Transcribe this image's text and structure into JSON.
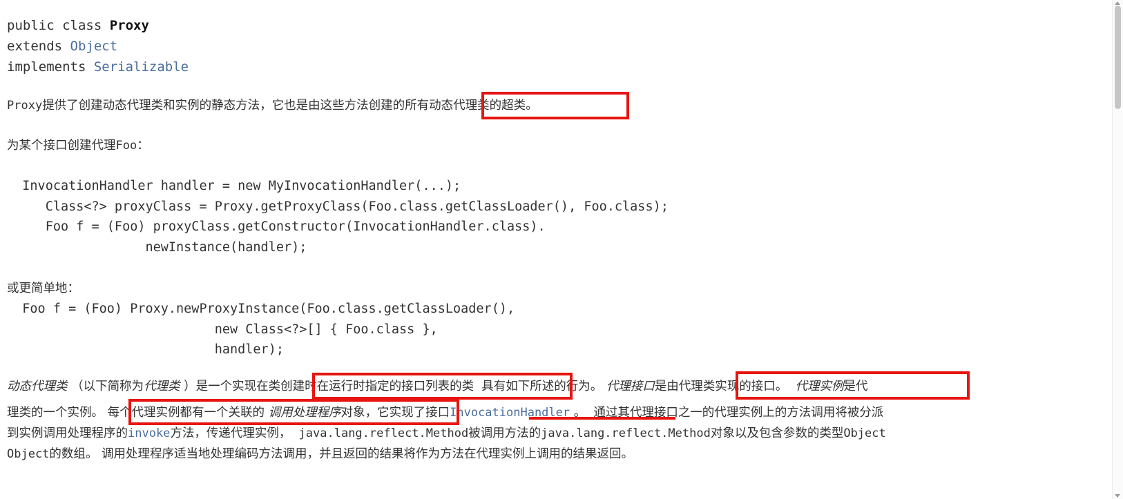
{
  "signature": {
    "line1_pre": "public class ",
    "line1_class": "Proxy",
    "line2_pre": "extends ",
    "line2_link": "Object",
    "line3_pre": "implements ",
    "line3_link": "Serializable"
  },
  "intro": {
    "part1": "Proxy",
    "part2": "提供了创建动态代理类和实例的静态方法，它也是由这些方法创建的",
    "highlight": "所有动态代理类的超类",
    "part3": "。"
  },
  "create_for_interface": {
    "text_pre": "为某个接口创建代理",
    "text_mono": "Foo",
    "text_post": "："
  },
  "code_block_1": {
    "line1": "  InvocationHandler handler = new MyInvocationHandler(...);",
    "line2": "     Class<?> proxyClass = Proxy.getProxyClass(Foo.class.getClassLoader(), Foo.class);",
    "line3": "     Foo f = (Foo) proxyClass.getConstructor(InvocationHandler.class).",
    "line4": "                  newInstance(handler);"
  },
  "simpler_label": "或更简单地：",
  "code_block_2": {
    "line1": "  Foo f = (Foo) Proxy.newProxyInstance(Foo.class.getClassLoader(),",
    "line2": "                           new Class<?>[] { Foo.class },",
    "line3": "                           handler);"
  },
  "body_paragraph": {
    "l1_a_italic": "动态代理类",
    "l1_b": " （以下简称为",
    "l1_c_italic": "代理类",
    "l1_d": " ）是一个实现",
    "l1_highlight1": "在类创建时在运行时指定的接口列表的类",
    "l1_e": "  具有如下所述的行为。 ",
    "l1_highlight2_italic": "代理接口",
    "l1_highlight2_rest": "是由代理类实现的接口。",
    "l1_f_italic": "代理实例",
    "l1_g": "是代",
    "l2_a": "理类的一个实例。 ",
    "l2_highlight_a": "每个代理实例都有一个关联的 ",
    "l2_highlight_b_italic": "调用处理程序",
    "l2_highlight_c": "对象，",
    "l2_b": "它实现了接口",
    "l2_link": "InvocationHandler",
    "l2_c": " 。  通过其代理接口之一的代理实例上的方法调用将被分派",
    "l3_a": "到实例调用处理程序的",
    "l3_link": "invoke",
    "l3_b": "方法，传递代理实例，  ",
    "l3_mono1": "java.lang.reflect.Method",
    "l3_c": "被调用方法的",
    "l3_mono2": "java.lang.reflect.Method",
    "l3_d": "对象以及包含参数的类型",
    "l3_mono3": "Object",
    "l4_mono": "Object",
    "l4_a": "的数组。 调用处理程序适当地处理编码方法调用，并且返回的结果将作为方法在代理实例上调用的结果返回。"
  },
  "annotations": {
    "accent_color": "#e8140f",
    "link_color": "#4a6d9e",
    "box1_label": "highlight-superclass",
    "box2_label": "highlight-interface-list",
    "box3_label": "highlight-proxy-interface",
    "box4_label": "highlight-invocation-handler-object",
    "underline_label": "underline-invocation-handler-link"
  }
}
